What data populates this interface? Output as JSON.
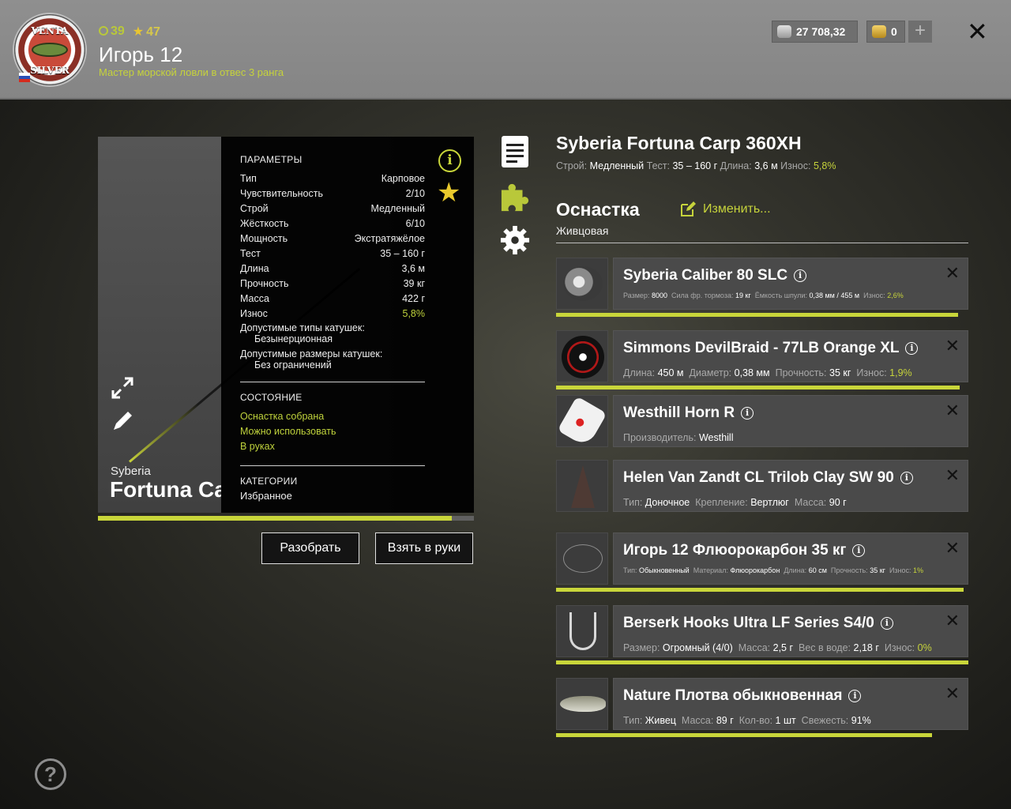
{
  "header": {
    "logo": {
      "top_text": "VENTA",
      "bottom_text": "SILVER"
    },
    "level": "39",
    "stars": "47",
    "player_name": "Игорь  12",
    "rank": "Мастер морской ловли в отвес 3 ранга",
    "silver": "27 708,32",
    "gold": "0",
    "plus_label": "+",
    "close_label": "✕"
  },
  "rod": {
    "brand": "Syberia",
    "model": "Fortuna Carp 360XH",
    "wear_bar_fraction": 0.942,
    "params_title": "ПАРАМЕТРЫ",
    "params": [
      {
        "label": "Тип",
        "value": "Карповое"
      },
      {
        "label": "Чувствительность",
        "value": "2/10"
      },
      {
        "label": "Строй",
        "value": "Медленный"
      },
      {
        "label": "Жёсткость",
        "value": "6/10"
      },
      {
        "label": "Мощность",
        "value": "Экстратяжёлое"
      },
      {
        "label": "Тест",
        "value": "35 – 160 г"
      },
      {
        "label": "Длина",
        "value": "3,6 м"
      },
      {
        "label": "Прочность",
        "value": "39 кг"
      },
      {
        "label": "Масса",
        "value": "422 г"
      },
      {
        "label": "Износ",
        "value": "5,8%"
      }
    ],
    "reel_types_label": "Допустимые типы катушек:",
    "reel_types_value": "Безынерционная",
    "reel_sizes_label": "Допустимые размеры катушек:",
    "reel_sizes_value": "Без ограничений",
    "state_title": "СОСТОЯНИЕ",
    "state": [
      "Оснастка собрана",
      "Можно использовать",
      "В руках"
    ],
    "cat_title": "КАТЕГОРИИ",
    "cat_value": "Избранное",
    "btn_disassemble": "Разобрать",
    "btn_take": "Взять в руки"
  },
  "details": {
    "title": "Syberia Fortuna Carp 360XH",
    "meta": [
      {
        "label": "Строй:",
        "value": "Медленный",
        "green": false
      },
      {
        "label": "Тест:",
        "value": "35 – 160 г",
        "green": false
      },
      {
        "label": "Длина:",
        "value": "3,6 м",
        "green": false
      },
      {
        "label": "Износ:",
        "value": "5,8%",
        "green": true
      }
    ],
    "tackle_title": "Оснастка",
    "tackle_type": "Живцовая",
    "change_label": "Изменить..."
  },
  "items": [
    {
      "name": "Syberia Caliber 80 SLC",
      "thumb": "reel",
      "small": true,
      "bar": 0.976,
      "info": [
        [
          "Размер:",
          "8000",
          false
        ],
        [
          "Сила фр. тормоза:",
          "19 кг",
          false
        ],
        [
          "Ёмкость шпули:",
          "0,38 мм / 455 м",
          false
        ],
        [
          "Износ:",
          "2,6%",
          true
        ]
      ]
    },
    {
      "name": "Simmons DevilBraid - 77LB Orange XL",
      "thumb": "braid",
      "small": false,
      "bar": 0.979,
      "info": [
        [
          "Длина:",
          "450 м",
          false
        ],
        [
          "Диаметр:",
          "0,38 мм",
          false
        ],
        [
          "Прочность:",
          "35 кг",
          false
        ],
        [
          "Износ:",
          "1,9%",
          true
        ]
      ]
    },
    {
      "name": "Westhill Horn R",
      "thumb": "alarm",
      "small": false,
      "bar": 0,
      "info": [
        [
          "Производитель:",
          "Westhill",
          false
        ]
      ]
    },
    {
      "name": "Helen Van Zandt CL Trilob Clay SW 90",
      "thumb": "sinker",
      "small": false,
      "bar": 0,
      "info": [
        [
          "Тип:",
          "Доночное",
          false
        ],
        [
          "Крепление:",
          "Вертлюг",
          false
        ],
        [
          "Масса:",
          "90 г",
          false
        ]
      ]
    },
    {
      "name": "Игорь  12 Флюорокарбон 35 кг",
      "thumb": "leader",
      "small": true,
      "bar": 0.988,
      "info": [
        [
          "Тип:",
          "Обыкновенный",
          false
        ],
        [
          "Материал:",
          "Флюорокарбон",
          false
        ],
        [
          "Длина:",
          "60 см",
          false
        ],
        [
          "Прочность:",
          "35 кг",
          false
        ],
        [
          "Износ:",
          "1%",
          true
        ]
      ]
    },
    {
      "name": "Berserk Hooks Ultra LF Series S4/0",
      "thumb": "hook",
      "small": false,
      "bar": 1.0,
      "info": [
        [
          "Размер:",
          "Огромный (4/0)",
          false
        ],
        [
          "Масса:",
          "2,5 г",
          false
        ],
        [
          "Вес в воде:",
          "2,18 г",
          false
        ],
        [
          "Износ:",
          "0%",
          true
        ]
      ]
    },
    {
      "name": "Nature Плотва обыкновенная",
      "thumb": "fish",
      "small": false,
      "bar": 0.912,
      "info": [
        [
          "Тип:",
          "Живец",
          false
        ],
        [
          "Масса:",
          "89 г",
          false
        ],
        [
          "Кол-во:",
          "1 шт",
          false
        ],
        [
          "Свежесть:",
          "91%",
          false
        ]
      ]
    }
  ],
  "help_label": "?",
  "colors": {
    "accent": "#c9d63a",
    "gold_star": "#e9c92c",
    "item_bg": "#4a4a4a"
  }
}
